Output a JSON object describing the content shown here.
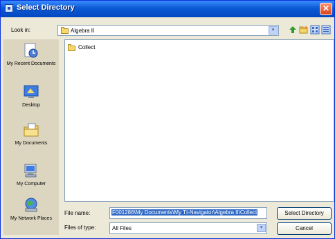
{
  "window": {
    "title": "Select Directory",
    "close_symbol": "✕"
  },
  "look_in": {
    "label": "Look in:",
    "value": "Algebra II"
  },
  "places": [
    {
      "label": "My Recent Documents"
    },
    {
      "label": "Desktop"
    },
    {
      "label": "My Documents"
    },
    {
      "label": "My Computer"
    },
    {
      "label": "My Network Places"
    }
  ],
  "files": [
    {
      "name": "Collect"
    }
  ],
  "file_name": {
    "label": "File name:",
    "value": "F001286\\My Documents\\My TI-Navigator\\Algebra II\\Collect"
  },
  "file_type": {
    "label": "Files of type:",
    "value": "All Files"
  },
  "buttons": {
    "select": "Select Directory",
    "cancel": "Cancel"
  },
  "glyphs": {
    "dropdown": "▾"
  }
}
